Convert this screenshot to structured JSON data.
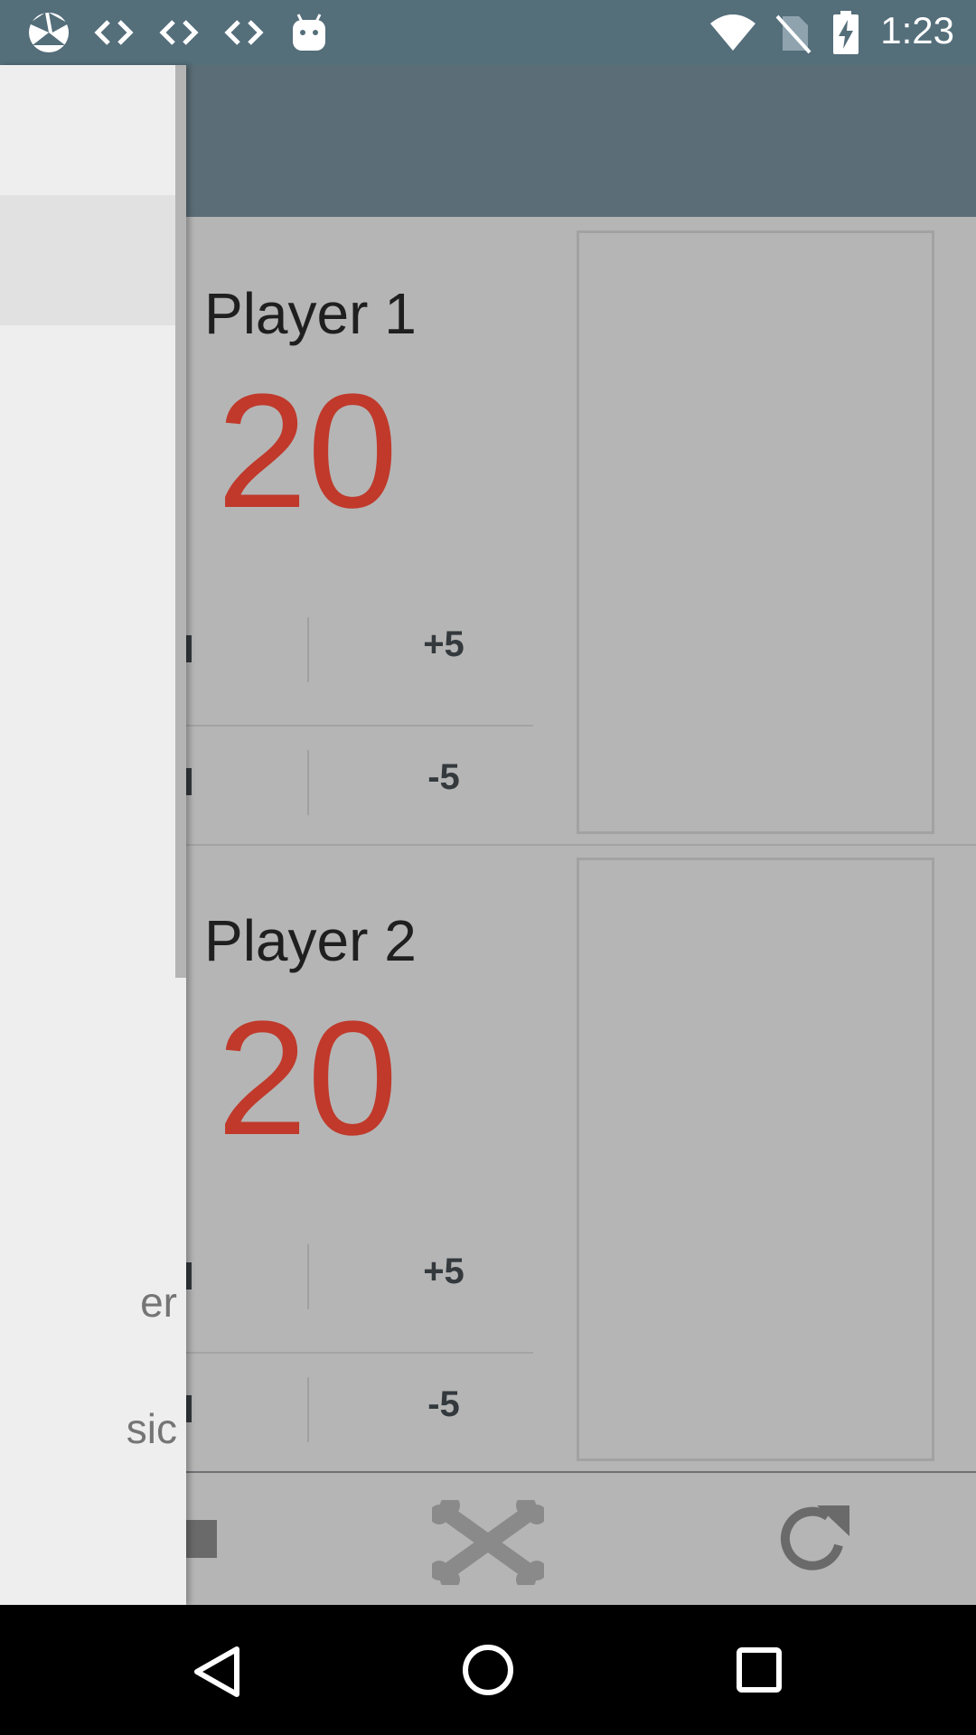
{
  "status_bar": {
    "time": "1:23",
    "icons": [
      "app-icon",
      "code-icon",
      "code-icon",
      "code-icon",
      "android-icon",
      "wifi-icon",
      "no-sim-icon",
      "battery-charging-icon"
    ]
  },
  "players": [
    {
      "name": "Player 1",
      "life": "20",
      "increment_label": "+5",
      "decrement_label": "-5"
    },
    {
      "name": "Player 2",
      "life": "20",
      "increment_label": "+5",
      "decrement_label": "-5"
    }
  ],
  "drawer": {
    "items": [
      {
        "label": "er"
      },
      {
        "label": "sic"
      }
    ]
  },
  "toolbar": {
    "icons": [
      "stop-icon",
      "crossbones-icon",
      "refresh-icon"
    ]
  },
  "nav": {
    "icons": [
      "back-icon",
      "home-icon",
      "recents-icon"
    ]
  },
  "colors": {
    "status_bar": "#546e7a",
    "app_bar": "#5b6e78",
    "life_total": "#c0392b",
    "scrim_background": "#b5b5b5",
    "drawer_background": "#eeeeee"
  }
}
